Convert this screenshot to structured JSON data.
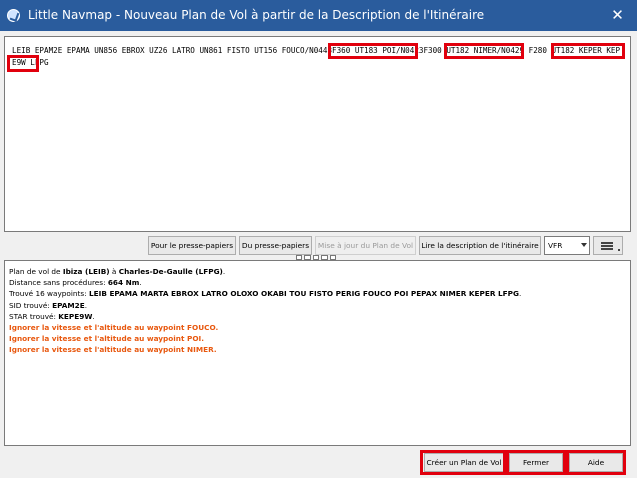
{
  "window": {
    "title": "Little Navmap - Nouveau Plan de Vol à partir de la Description de l'Itinéraire",
    "close_glyph": "✕"
  },
  "route_text": "LEIB EPAM2E EPAMA UN856 EBROX UZ26 LATRO UN861 FISTO UT156 FOUCO/N0443F360 UT183 POI/N0423F300 UT182 NIMER/N0429 F280 UT182 KEPER KEPE9W LFPG",
  "toolbar": {
    "from_clipboard": "Pour le presse-papiers",
    "to_clipboard": "Du presse-papiers",
    "update_plan": "Mise à jour du Plan de Vol",
    "read_description": "Lire la description de l'itinéraire",
    "flight_rules": "VFR"
  },
  "log": {
    "l1_pre": "Plan de vol de ",
    "l1_from": "Ibiza (LEIB)",
    "l1_mid": " à ",
    "l1_to": "Charles-De-Gaulle (LFPG)",
    "l1_end": ".",
    "l2_pre": "Distance sans procédures: ",
    "l2_val": "664 Nm",
    "l2_end": ".",
    "l3_pre": "Trouvé 16 waypoints: ",
    "l3_val": "LEIB EPAMA MARTA EBROX LATRO OLOXO OKABI TOU FISTO PERIG FOUCO POI PEPAX NIMER KEPER LFPG",
    "l3_end": ".",
    "l4_pre": "SID trouvé: ",
    "l4_val": "EPAM2E",
    "l4_end": ".",
    "l5_pre": "STAR trouvé: ",
    "l5_val": "KEPE9W",
    "l5_end": ".",
    "warn1": "Ignorer la vitesse et l'altitude au waypoint FOUCO.",
    "warn2": "Ignorer la vitesse et l'altitude au waypoint POI.",
    "warn3": "Ignorer la vitesse et l'altitude au waypoint NIMER."
  },
  "footer": {
    "create_plan": "Créer un Plan de Vol",
    "close": "Fermer",
    "help": "Aide"
  },
  "colors": {
    "titlebar": "#2a5c9d",
    "highlight": "#e1000d",
    "warning": "#e8580f"
  }
}
